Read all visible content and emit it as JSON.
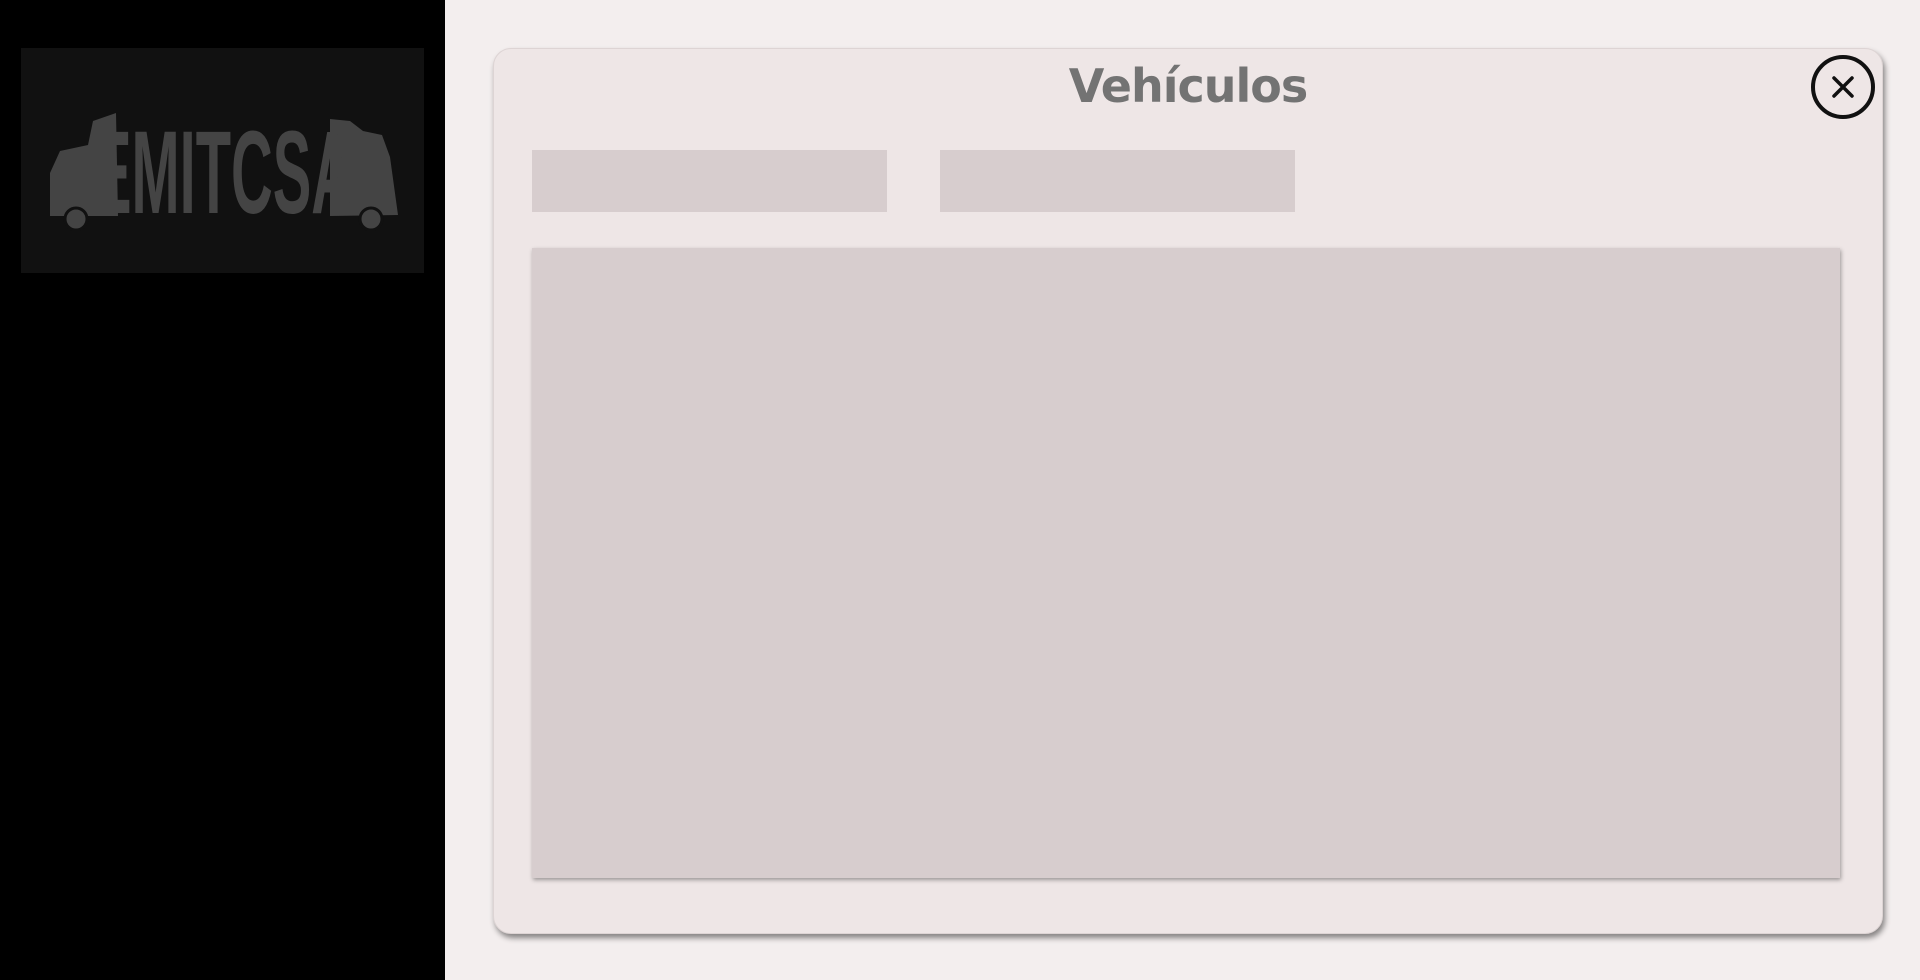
{
  "sidebar": {
    "logo": {
      "text": "EMITCSA",
      "icon": "van-logo-icon"
    }
  },
  "panel": {
    "title": "Vehículos",
    "close_icon": "close-icon",
    "fields": [
      {
        "value": "",
        "placeholder": ""
      },
      {
        "value": "",
        "placeholder": ""
      }
    ]
  },
  "colors": {
    "sidebar_bg": "#000000",
    "logo_bg": "#111111",
    "logo_fg": "#444444",
    "page_bg": "#f3eeee",
    "panel_bg": "#eee6e6",
    "field_bg": "#d7cdce",
    "title_color": "#737373"
  }
}
